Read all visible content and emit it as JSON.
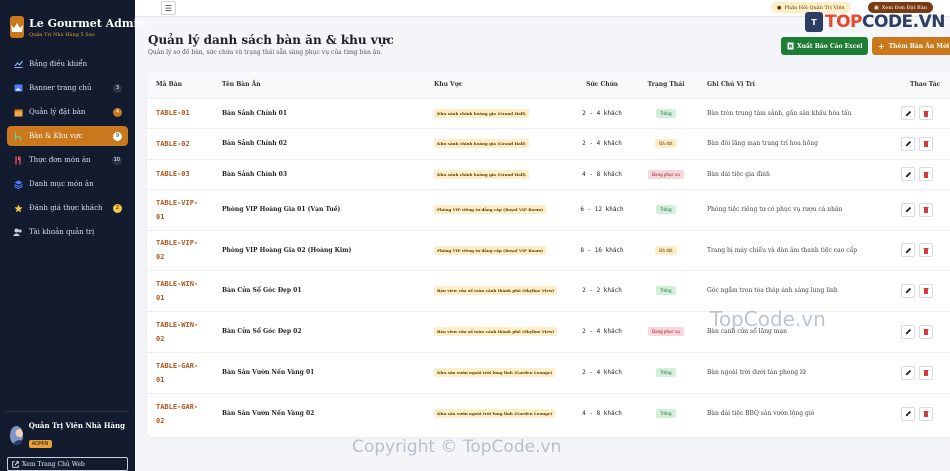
{
  "brand": {
    "title": "Le Gourmet Admin",
    "subtitle": "Quản Trị Nhà Hàng 5 Sao"
  },
  "sidebar": {
    "items": [
      {
        "label": "Bảng điều khiển",
        "icon": "chart-line-icon",
        "badge": ""
      },
      {
        "label": "Banner trang chủ",
        "icon": "image-icon",
        "badge": "3"
      },
      {
        "label": "Quản lý đặt bàn",
        "icon": "calendar-icon",
        "badge": "4"
      },
      {
        "label": "Bàn & Khu vực",
        "icon": "chair-icon",
        "badge": "9",
        "active": true
      },
      {
        "label": "Thực đơn món ăn",
        "icon": "utensils-icon",
        "badge": "10"
      },
      {
        "label": "Danh mục món ăn",
        "icon": "layers-icon",
        "badge": ""
      },
      {
        "label": "Đánh giá thực khách",
        "icon": "star-icon",
        "badge": "2"
      },
      {
        "label": "Tài khoản quản trị",
        "icon": "users-icon",
        "badge": ""
      }
    ],
    "user": {
      "name": "Quản Trị Viên Nhà Hàng",
      "role": "ADMIN"
    },
    "home_link": "Xem Trang Chủ Web"
  },
  "topbar": {
    "feedback": "Phản Hồi Quản Trị Viên",
    "view_bookings": "Xem Đơn Đặt Bàn"
  },
  "watermark": {
    "logo": "TOPCODE.VN",
    "logo_accent": "TOP",
    "logo_rest": "CODE.VN",
    "big": "TopCode.vn",
    "copyright": "Copyright © TopCode.vn"
  },
  "page": {
    "title": "Quản lý danh sách bàn ăn & khu vực",
    "subtitle": "Quản lý sơ đồ bàn, sức chứa và trạng thái sẵn sàng phục vụ của từng bàn ăn.",
    "export_btn": "Xuất Báo Cáo Excel",
    "add_btn": "Thêm Bàn Ăn Mới"
  },
  "table": {
    "headers": [
      "Mã Bàn",
      "Tên Bàn Ăn",
      "Khu Vực",
      "Sức Chứa",
      "Trạng Thái",
      "Ghi Chú Vị Trí",
      "Thao Tác"
    ],
    "rows": [
      {
        "id": "TABLE-01",
        "name": "Bàn Sảnh Chính 01",
        "area": "Khu sảnh chính hoàng gia (Grand Hall)",
        "capacity": "2 - 4 khách",
        "status": "Trống",
        "status_type": "empty",
        "note": "Bàn tròn trung tâm sảnh, gần sân khấu hòa tấu"
      },
      {
        "id": "TABLE-02",
        "name": "Bàn Sảnh Chính 02",
        "area": "Khu sảnh chính hoàng gia (Grand Hall)",
        "capacity": "2 - 4 khách",
        "status": "Đã đặt",
        "status_type": "booked",
        "note": "Bàn đôi lãng mạn trang trí hoa hồng"
      },
      {
        "id": "TABLE-03",
        "name": "Bàn Sảnh Chính 03",
        "area": "Khu sảnh chính hoàng gia (Grand Hall)",
        "capacity": "4 - 8 khách",
        "status": "Đang phục vụ",
        "status_type": "busy",
        "note": "Bàn dài tiệc gia đình"
      },
      {
        "id": "TABLE-VIP-01",
        "name": "Phòng VIP Hoàng Gia 01 (Vạn Tuế)",
        "area": "Phòng VIP riêng tư đẳng cấp (Royal VIP Room)",
        "capacity": "6 - 12 khách",
        "status": "Trống",
        "status_type": "empty",
        "note": "Phòng tiệc riêng tư có phục vụ rượu cá nhân"
      },
      {
        "id": "TABLE-VIP-02",
        "name": "Phòng VIP Hoàng Gia 02 (Hoàng Kim)",
        "area": "Phòng VIP riêng tư đẳng cấp (Royal VIP Room)",
        "capacity": "8 - 16 khách",
        "status": "Đã đặt",
        "status_type": "booked",
        "note": "Trang bị máy chiếu và dàn âm thanh tiệc cao cấp"
      },
      {
        "id": "TABLE-WIN-01",
        "name": "Bàn Cửa Sổ Góc Đẹp 01",
        "area": "Bàn view cửa sổ toàn cảnh thành phố (Skyline View)",
        "capacity": "2 - 2 khách",
        "status": "Trống",
        "status_type": "empty",
        "note": "Góc ngắm trọn tòa tháp ánh sáng lung linh"
      },
      {
        "id": "TABLE-WIN-02",
        "name": "Bàn Cửa Sổ Góc Đẹp 02",
        "area": "Bàn view cửa sổ toàn cảnh thành phố (Skyline View)",
        "capacity": "2 - 4 khách",
        "status": "Đang phục vụ",
        "status_type": "busy",
        "note": "Bàn cạnh cửa sổ lãng mạn"
      },
      {
        "id": "TABLE-GAR-01",
        "name": "Bàn Sân Vườn Nến Vàng 01",
        "area": "Khu sân vườn ngoài trời lung linh (Garden Lounge)",
        "capacity": "2 - 4 khách",
        "status": "Trống",
        "status_type": "empty",
        "note": "Bàn ngoài trời dưới tán phong lữ"
      },
      {
        "id": "TABLE-GAR-02",
        "name": "Bàn Sân Vườn Nến Vàng 02",
        "area": "Khu sân vườn ngoài trời lung linh (Garden Lounge)",
        "capacity": "4 - 8 khách",
        "status": "Trống",
        "status_type": "empty",
        "note": "Bàn dài tiệc BBQ sân vườn lộng gió"
      }
    ]
  },
  "colors": {
    "accent": "#c9781b",
    "sidebar": "#131b2e",
    "excel": "#1e7d34"
  }
}
